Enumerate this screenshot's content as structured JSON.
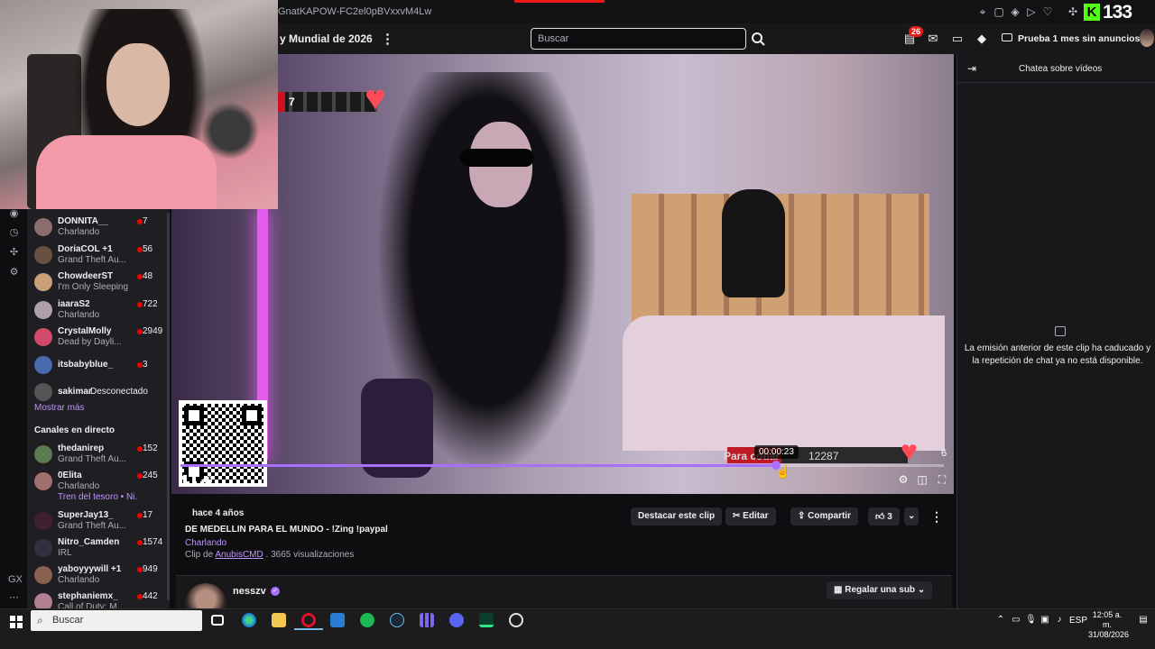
{
  "browser": {
    "url": "GnatKAPOW-FC2el0pBVxxvM4Lw",
    "extension_count": "133"
  },
  "topnav": {
    "stream_title": "y Mundial de 2026",
    "search_placeholder": "Buscar",
    "notification_count": "26",
    "prime_label": "Prueba 1 mes sin anuncios"
  },
  "sidebar": {
    "followed": [
      {
        "name": "DONNITA__",
        "sub": "Charlando",
        "count": "7",
        "color": "#8b6f70"
      },
      {
        "name": "DoriaCOL +1",
        "sub": "Grand Theft Au...",
        "count": "56",
        "color": "#6a5040"
      },
      {
        "name": "ChowdeerST",
        "sub": "I'm Only Sleeping",
        "count": "48",
        "color": "#c9a079"
      },
      {
        "name": "iaaraS2",
        "sub": "Charlando",
        "count": "722",
        "color": "#b0a0a8"
      },
      {
        "name": "CrystalMolly",
        "sub": "Dead by Dayli...",
        "count": "2949",
        "color": "#d04a6a"
      },
      {
        "name": "itsbabyblue_",
        "sub": "",
        "count": "3",
        "color": "#4a6ab0"
      },
      {
        "name": "sakimar",
        "sub": "",
        "count": "",
        "status": "Desconectado",
        "color": "#555555"
      }
    ],
    "show_more": "Mostrar más",
    "live_section_title": "Canales en directo",
    "live": [
      {
        "name": "thedanirep",
        "sub": "Grand Theft Au...",
        "count": "152",
        "color": "#5a7a50"
      },
      {
        "name": "0Elita",
        "sub": "Charlando",
        "sub2": "Tren del tesoro • Ni...",
        "count": "245",
        "color": "#a07070"
      },
      {
        "name": "SuperJay13_",
        "sub": "Grand Theft Au...",
        "count": "17",
        "color": "#402030"
      },
      {
        "name": "Nitro_Camden",
        "sub": "IRL",
        "count": "1574",
        "color": "#303040"
      },
      {
        "name": "yaboyyywill +1",
        "sub": "Charlando",
        "count": "949",
        "color": "#8a6050"
      },
      {
        "name": "stephaniemx_",
        "sub": "Call of Duty: M...",
        "count": "442",
        "color": "#b08090"
      }
    ]
  },
  "video": {
    "overlay_hearts": "7",
    "goal_text": "Para cotiar",
    "goal_value": "12287",
    "goal_six": "6",
    "timestamp": "00:00:23",
    "progress": 0.78
  },
  "clip": {
    "time_ago": "hace 4 años",
    "title": "DE MEDELLIN PARA EL MUNDO - !Zing !paypal",
    "category": "Charlando",
    "clip_by_prefix": "Clip de",
    "author": "AnubisCMD",
    "views": " . 3665 visualizaciones",
    "actions": {
      "highlight": "Destacar este clip",
      "edit": "Editar",
      "share": "Compartir",
      "likes": "3"
    },
    "streamer": "nesszv",
    "gift_sub": "Regalar una sub"
  },
  "chat": {
    "title": "Chatea sobre vídeos",
    "empty_message": "La emisión anterior de este clip ha caducado y la repetición de chat ya no está disponible."
  },
  "taskbar": {
    "search_placeholder": "Buscar",
    "language": "ESP",
    "time": "12:05 a. m.",
    "date": "31/08/2026"
  }
}
